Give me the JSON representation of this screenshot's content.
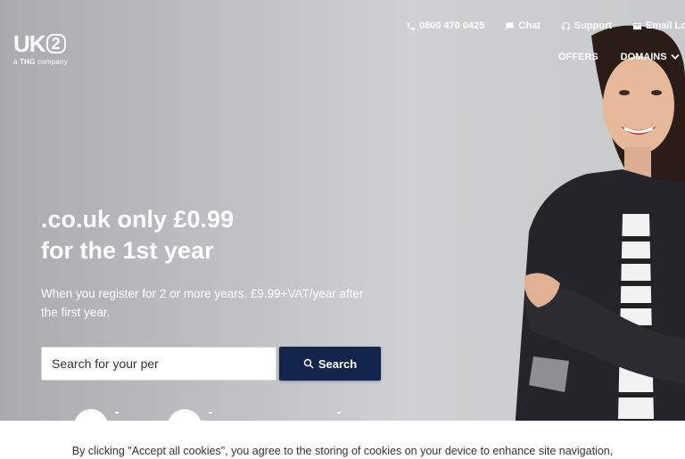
{
  "logo": {
    "mark": "UK",
    "mark_badge": "2",
    "tagline_prefix": "a",
    "tagline_brand": "THG",
    "tagline_suffix": "company"
  },
  "topbar": {
    "phone": "0800 470 0425",
    "chat": "Chat",
    "support": "Support",
    "email": "Email Lo"
  },
  "nav": {
    "offers": "OFFERS",
    "domains": "DOMAINS"
  },
  "hero": {
    "headline_line1": ".co.uk only £0.99",
    "headline_line2": "for the 1st year",
    "subtext": "When you register for 2 or more years. £9.99+VAT/year after the first year."
  },
  "search": {
    "value": "Search for your per",
    "button_label": "Search"
  },
  "cookie_banner": {
    "text": "By clicking \"Accept all cookies\", you agree to the storing of cookies on your device to enhance site navigation,"
  },
  "colors": {
    "search_button": "#14254d",
    "background": "#c2c4c5"
  },
  "icons": [
    "phone-icon",
    "chat-icon",
    "headset-icon",
    "mail-icon",
    "chevron-down-icon",
    "search-icon"
  ]
}
